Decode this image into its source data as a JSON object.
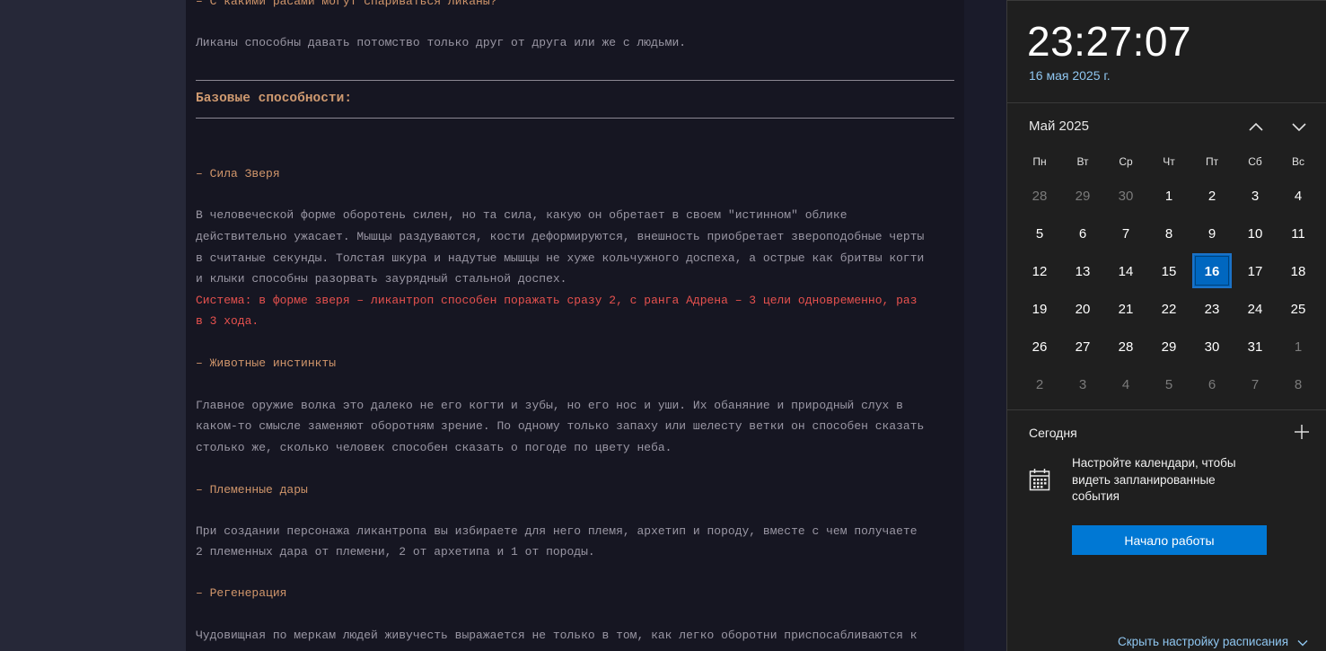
{
  "article": {
    "line_top": "– С какими расами могут спариваться ликаны?",
    "line_breeding": "Ликаны способны давать потомство только друг от друга или же с людьми.",
    "heading_base": "Базовые способности:",
    "beast_title": "– Сила Зверя",
    "beast_p1": "В человеческой форме оборотень силен, но та сила, какую он обретает в своем \"истинном\" облике",
    "beast_p2": "действительно ужасает. Мышцы раздуваются, кости деформируются, внешность приобретает звероподобные черты",
    "beast_p3": "в считаные секунды. Толстая шкура и надутые мышцы не хуже кольчужного доспеха, а острые как бритвы когти",
    "beast_p4": "и клыки способны разорвать заурядный стальной доспех.",
    "system_1": "Система: в форме зверя – ликантроп способен поражать сразу 2, с ранга Адрена – 3 цели одновременно, раз",
    "system_2": "в 3 хода.",
    "instinct_title": "– Животные инстинкты",
    "instinct_p1": "Главное оружие волка это далеко не его когти и зубы, но его нос и уши. Их обаняние и природный слух в",
    "instinct_p2": "каком-то смысле заменяют оборотням зрение. По одному только запаху или шелесту ветки он способен сказать",
    "instinct_p3": "столько же, сколько человек способен сказать о погоде по цвету неба.",
    "tribal_title": "– Племенные дары",
    "tribal_p1": "При создании персонажа ликантропа вы избираете для него племя, архетип и породу, вместе с чем получаете",
    "tribal_p2": "2 племенных дара от племени, 2 от архетипа и 1 от породы.",
    "regen_title": "– Регенерация",
    "regen_p1": "Чудовищная по меркам людей живучесть выражается не только в том, как легко оборотни приспосабливаются к"
  },
  "calendar": {
    "clock": "23:27:07",
    "date_full": "16 мая 2025 г.",
    "month_label": "Май 2025",
    "weekdays": [
      "Пн",
      "Вт",
      "Ср",
      "Чт",
      "Пт",
      "Сб",
      "Вс"
    ],
    "weeks": [
      [
        {
          "d": "28",
          "o": true
        },
        {
          "d": "29",
          "o": true
        },
        {
          "d": "30",
          "o": true
        },
        {
          "d": "1"
        },
        {
          "d": "2"
        },
        {
          "d": "3"
        },
        {
          "d": "4"
        }
      ],
      [
        {
          "d": "5"
        },
        {
          "d": "6"
        },
        {
          "d": "7"
        },
        {
          "d": "8"
        },
        {
          "d": "9"
        },
        {
          "d": "10"
        },
        {
          "d": "11"
        }
      ],
      [
        {
          "d": "12"
        },
        {
          "d": "13"
        },
        {
          "d": "14"
        },
        {
          "d": "15"
        },
        {
          "d": "16",
          "t": true
        },
        {
          "d": "17"
        },
        {
          "d": "18"
        }
      ],
      [
        {
          "d": "19"
        },
        {
          "d": "20"
        },
        {
          "d": "21"
        },
        {
          "d": "22"
        },
        {
          "d": "23"
        },
        {
          "d": "24"
        },
        {
          "d": "25"
        }
      ],
      [
        {
          "d": "26"
        },
        {
          "d": "27"
        },
        {
          "d": "28"
        },
        {
          "d": "29"
        },
        {
          "d": "30"
        },
        {
          "d": "31"
        },
        {
          "d": "1",
          "o": true
        }
      ],
      [
        {
          "d": "2",
          "o": true
        },
        {
          "d": "3",
          "o": true
        },
        {
          "d": "4",
          "o": true
        },
        {
          "d": "5",
          "o": true
        },
        {
          "d": "6",
          "o": true
        },
        {
          "d": "7",
          "o": true
        },
        {
          "d": "8",
          "o": true
        }
      ]
    ],
    "today_label": "Сегодня",
    "setup_text": "Настройте календари, чтобы видеть запланированные события",
    "start_button": "Начало работы",
    "hide_link": "Скрыть настройку расписания",
    "icons": {
      "prev": "chevron-up-icon",
      "next": "chevron-down-icon",
      "add": "plus-icon",
      "calendar": "calendar-icon",
      "hide": "chevron-down-icon"
    },
    "colors": {
      "accent": "#0078d4",
      "today": "#0067c0",
      "link": "#8fc6f0"
    }
  }
}
